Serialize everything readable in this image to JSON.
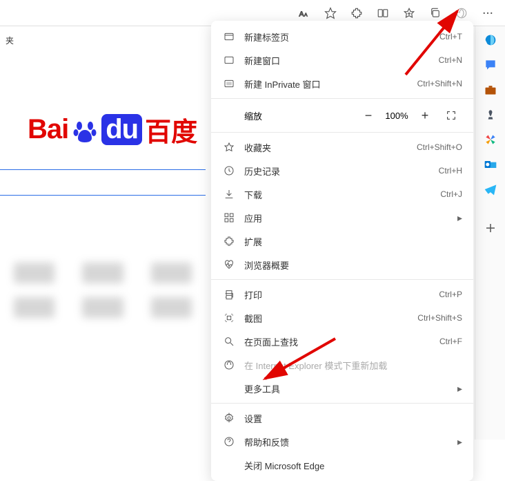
{
  "breadcrumb": "夹",
  "logo": {
    "latin": "Bai",
    "du": "du",
    "cn": "百度"
  },
  "toolbar": {
    "items": [
      "text-size",
      "favorite",
      "extensions",
      "split",
      "collections",
      "duplicate",
      "ie-mode",
      "menu"
    ]
  },
  "sidebar": {
    "items": [
      "copilot",
      "chat",
      "briefcase",
      "chess",
      "pinwheel",
      "outlook",
      "telegram",
      "add"
    ]
  },
  "menu": {
    "newTab": {
      "label": "新建标签页",
      "shortcut": "Ctrl+T"
    },
    "newWindow": {
      "label": "新建窗口",
      "shortcut": "Ctrl+N"
    },
    "newInPrivate": {
      "label": "新建 InPrivate 窗口",
      "shortcut": "Ctrl+Shift+N"
    },
    "zoom": {
      "label": "缩放",
      "value": "100%"
    },
    "favorites": {
      "label": "收藏夹",
      "shortcut": "Ctrl+Shift+O"
    },
    "history": {
      "label": "历史记录",
      "shortcut": "Ctrl+H"
    },
    "downloads": {
      "label": "下载",
      "shortcut": "Ctrl+J"
    },
    "apps": {
      "label": "应用"
    },
    "extensions": {
      "label": "扩展"
    },
    "browserEssentials": {
      "label": "浏览器概要"
    },
    "print": {
      "label": "打印",
      "shortcut": "Ctrl+P"
    },
    "screenshot": {
      "label": "截图",
      "shortcut": "Ctrl+Shift+S"
    },
    "findOnPage": {
      "label": "在页面上查找",
      "shortcut": "Ctrl+F"
    },
    "ieReload": {
      "label": "在 Internet Explorer 模式下重新加载"
    },
    "moreTools": {
      "label": "更多工具"
    },
    "settings": {
      "label": "设置"
    },
    "helpFeedback": {
      "label": "帮助和反馈"
    },
    "closeEdge": {
      "label": "关闭 Microsoft Edge"
    }
  }
}
